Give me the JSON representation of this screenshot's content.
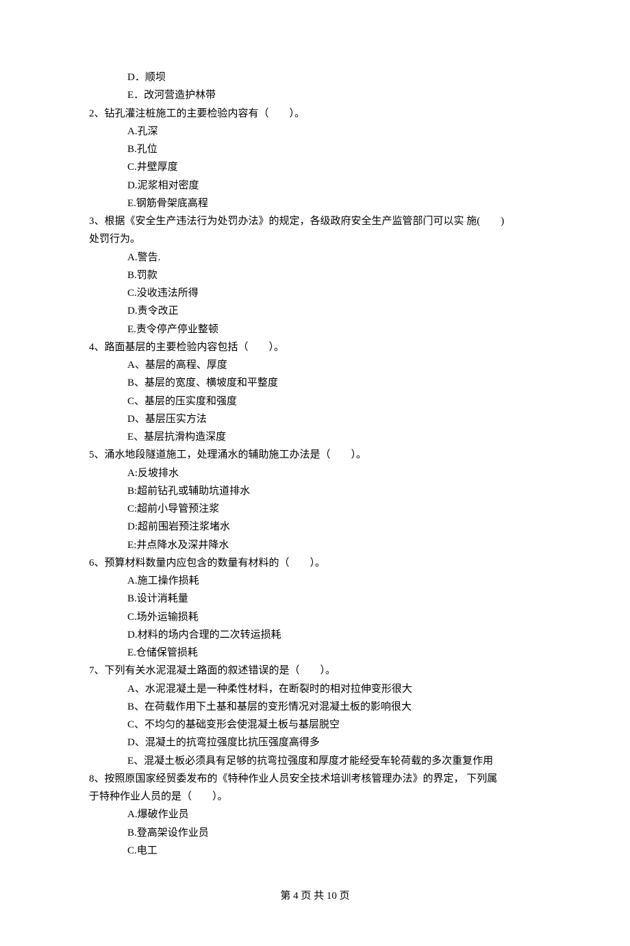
{
  "orphan_options": [
    "D．顺坝",
    "E．改河营造护林带"
  ],
  "questions": [
    {
      "number": "2",
      "stem": "钻孔灌注桩施工的主要检验内容有（　　）。",
      "options": [
        "A.孔深",
        "B.孔位",
        "C.井壁厚度",
        "D.泥浆相对密度",
        "E.钢筋骨架底高程"
      ]
    },
    {
      "number": "3",
      "stem": "根据《安全生产违法行为处罚办法》的规定，各级政府安全生产监管部门可以实 施(　　)",
      "stem_cont": "处罚行为。",
      "options": [
        "A.警告.",
        "B.罚款",
        "C.没收违法所得",
        "D.责令改正",
        "E.责令停产停业整顿"
      ]
    },
    {
      "number": "4",
      "stem": "路面基层的主要检验内容包括（　　）。",
      "options": [
        "A、基层的高程、厚度",
        "B、基层的宽度、横坡度和平整度",
        "C、基层的压实度和强度",
        "D、基层压实方法",
        "E、基层抗滑构造深度"
      ]
    },
    {
      "number": "5",
      "stem": "涌水地段隧道施工，处理涌水的辅助施工办法是（　　）。",
      "options": [
        "A:反坡排水",
        "B:超前钻孔或辅助坑道排水",
        "C:超前小导管预注浆",
        "D:超前围岩预注浆堵水",
        "E:井点降水及深井降水"
      ]
    },
    {
      "number": "6",
      "stem": "预算材料数量内应包含的数量有材料的（　　）。",
      "options": [
        "A.施工操作损耗",
        "B.设计消耗量",
        "C.场外运输损耗",
        "D.材料的场内合理的二次转运损耗",
        "E.仓储保管损耗"
      ]
    },
    {
      "number": "7",
      "stem": "下列有关水泥混凝土路面的叙述错误的是（　　）。",
      "options": [
        "A、水泥混凝土是一种柔性材料，在断裂时的相对拉伸变形很大",
        "B、在荷载作用下土基和基层的变形情况对混凝土板的影响很大",
        "C、不均匀的基础变形会使混凝土板与基层脱空",
        "D、混凝土的抗弯拉强度比抗压强度高得多",
        "E、混凝土板必须具有足够的抗弯拉强度和厚度才能经受车轮荷载的多次重复作用"
      ]
    },
    {
      "number": "8",
      "stem": "按照原国家经贸委发布的《特种作业人员安全技术培训考核管理办法》的界定， 下列属",
      "stem_cont": "于特种作业人员的是（　　）。",
      "options": [
        "A.爆破作业员",
        "B.登高架设作业员",
        "C.电工"
      ]
    }
  ],
  "footer": "第 4 页 共 10 页"
}
